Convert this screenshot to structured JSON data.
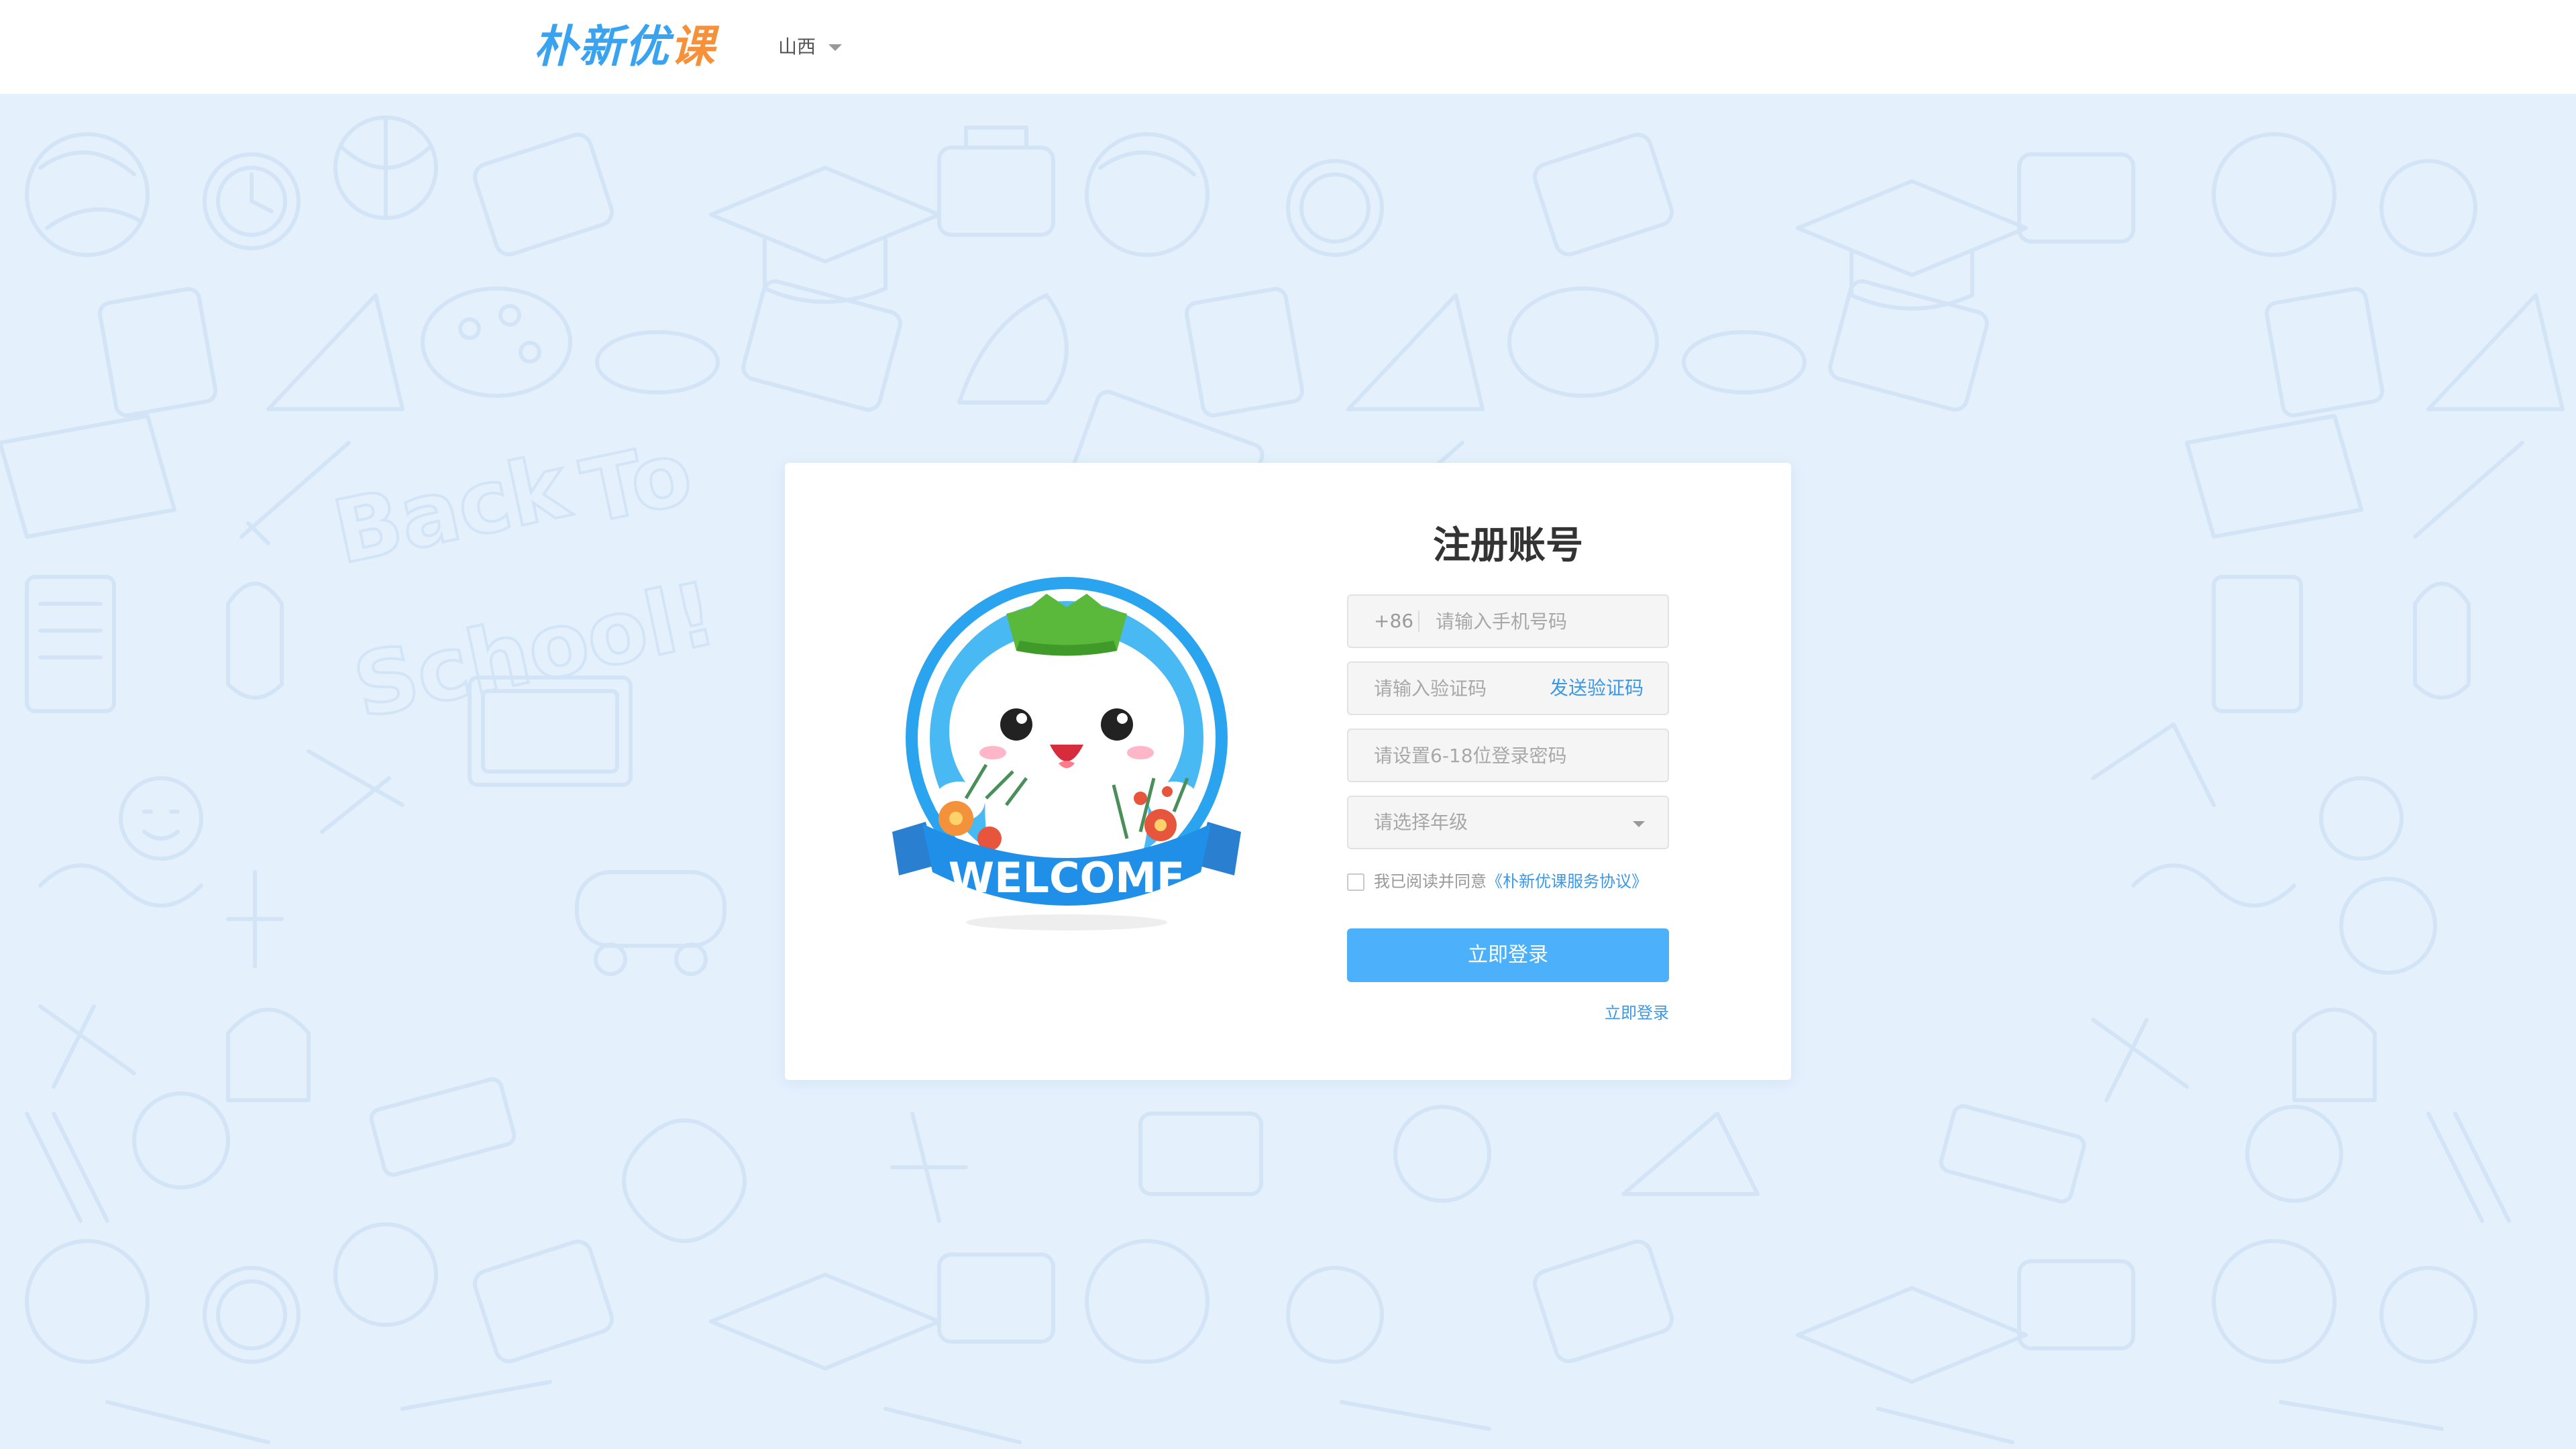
{
  "header": {
    "logo_main": "朴新优",
    "logo_accent": "课",
    "region": "山西"
  },
  "background": {
    "doodle_text_1": "Back",
    "doodle_text_2": "To",
    "doodle_text_3": "School!"
  },
  "mascot": {
    "banner_text": "WELCOME"
  },
  "form": {
    "title": "注册账号",
    "phone_prefix": "+86",
    "phone_placeholder": "请输入手机号码",
    "code_placeholder": "请输入验证码",
    "send_code": "发送验证码",
    "password_placeholder": "请设置6-18位登录密码",
    "grade_placeholder": "请选择年级",
    "agree_text": "我已阅读并同意",
    "agree_link": "《朴新优课服务协议》",
    "submit_label": "立即登录",
    "login_link": "立即登录"
  },
  "colors": {
    "accent": "#4cb0fb",
    "link": "#3a98e8",
    "background": "#e4f0fc"
  }
}
